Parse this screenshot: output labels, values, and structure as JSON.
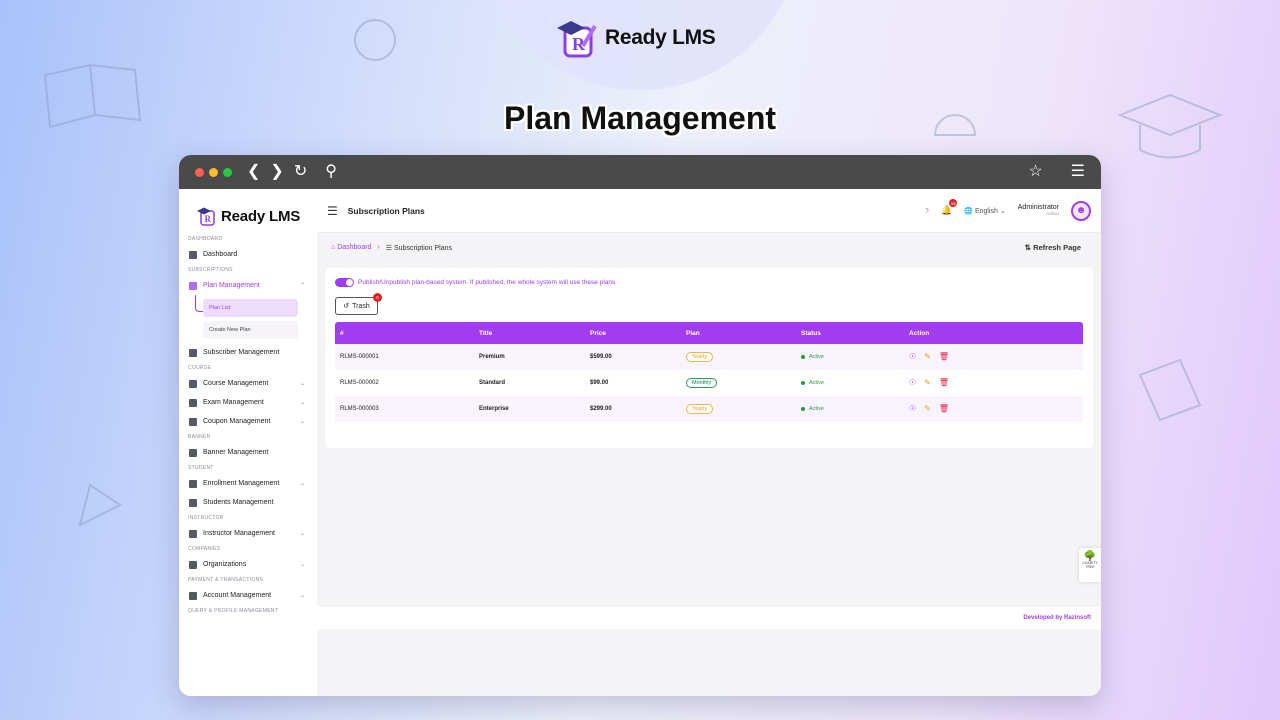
{
  "brand": {
    "name": "Ready LMS",
    "logo_letter": "R"
  },
  "hero": {
    "title": "Plan Management"
  },
  "colors": {
    "accent": "#a23cf0",
    "danger": "#e52020",
    "success": "#1f9d3a",
    "warning": "#e8a020"
  },
  "browser": {
    "icons": [
      "back-icon",
      "forward-icon",
      "reload-icon",
      "search-icon",
      "star-icon",
      "menu-icon"
    ]
  },
  "sidebar": {
    "brand": "Ready LMS",
    "sections": {
      "dashboard": "DASHBOARD",
      "subscriptions": "SUBSCRIPTIONS",
      "course": "COURSE",
      "banner": "BANNER",
      "student": "STUDENT",
      "instructor": "INSTRUCTOR",
      "companies": "COMPANIES",
      "payment": "PAYMENT & TRANSACTIONS",
      "query": "QUERY & PROFILE MANAGEMENT"
    },
    "items": {
      "dashboard": "Dashboard",
      "plan_management": "Plan Management",
      "plan_list": "Plan List",
      "create_new_plan": "Create New Plan",
      "subscriber_management": "Subscriber Management",
      "course_management": "Course Management",
      "exam_management": "Exam Management",
      "coupon_management": "Coupon Management",
      "banner_management": "Banner Management",
      "enrollment_management": "Enrollment Management",
      "students_management": "Students Management",
      "instructor_management": "Instructor Management",
      "organizations": "Organizations",
      "account_management": "Account Management"
    }
  },
  "topbar": {
    "title": "Subscription Plans",
    "notification_count": "15",
    "language": "English",
    "user_name": "Administrator",
    "user_role": "Admin"
  },
  "breadcrumb": {
    "home": "Dashboard",
    "current": "Subscription Plans"
  },
  "refresh_label": "Refresh Page",
  "publish_text": "Publish/Unpublish plan-based system. If published, the whole system will use these plans",
  "trash": {
    "label": "Trash",
    "count": "0"
  },
  "table": {
    "headers": [
      "#",
      "Title",
      "Price",
      "Plan",
      "Status",
      "Action"
    ],
    "rows": [
      {
        "id": "RLMS-000001",
        "title": "Premium",
        "price": "$599.00",
        "plan": "Yearly",
        "status": "Active"
      },
      {
        "id": "RLMS-000002",
        "title": "Standard",
        "price": "$99.00",
        "plan": "Monthly",
        "status": "Active"
      },
      {
        "id": "RLMS-000003",
        "title": "Enterprise",
        "price": "$299.00",
        "plan": "Yearly",
        "status": "Active"
      }
    ]
  },
  "footer": {
    "text": "Developed by Razinsoft"
  },
  "charity": {
    "line1": "CHARITY",
    "line2": "TREE"
  }
}
